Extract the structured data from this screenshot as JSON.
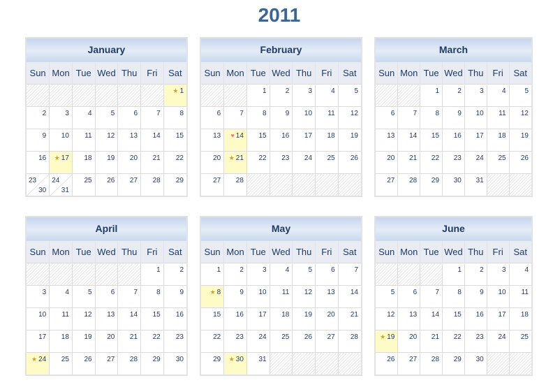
{
  "year": "2011",
  "weekdays": [
    "Sun",
    "Mon",
    "Tue",
    "Wed",
    "Thu",
    "Fri",
    "Sat"
  ],
  "icons": {
    "star": "star-icon",
    "heart": "heart-icon"
  },
  "colors": {
    "title": "#3a6595",
    "highlight": "#fffbc7",
    "star": "#d6a418",
    "heart": "#e07a86"
  },
  "months": [
    {
      "name": "January",
      "weeks": [
        [
          null,
          null,
          null,
          null,
          null,
          null,
          {
            "d": "1",
            "icon": "star"
          }
        ],
        [
          "2",
          "3",
          "4",
          "5",
          "6",
          "7",
          "8"
        ],
        [
          "9",
          "10",
          "11",
          "12",
          "13",
          "14",
          "15"
        ],
        [
          "16",
          {
            "d": "17",
            "icon": "star"
          },
          "18",
          "19",
          "20",
          "21",
          "22"
        ],
        [
          {
            "d": "23",
            "d2": "30"
          },
          {
            "d": "24",
            "d2": "31"
          },
          "25",
          "26",
          "27",
          "28",
          "29"
        ]
      ]
    },
    {
      "name": "February",
      "weeks": [
        [
          null,
          null,
          "1",
          "2",
          "3",
          "4",
          "5"
        ],
        [
          "6",
          "7",
          "8",
          "9",
          "10",
          "11",
          "12"
        ],
        [
          "13",
          {
            "d": "14",
            "icon": "heart"
          },
          "15",
          "16",
          "17",
          "18",
          "19"
        ],
        [
          "20",
          {
            "d": "21",
            "icon": "star"
          },
          "22",
          "23",
          "24",
          "25",
          "26"
        ],
        [
          "27",
          "28",
          null,
          null,
          null,
          null,
          null
        ]
      ]
    },
    {
      "name": "March",
      "weeks": [
        [
          null,
          null,
          "1",
          "2",
          "3",
          "4",
          "5"
        ],
        [
          "6",
          "7",
          "8",
          "9",
          "10",
          "11",
          "12"
        ],
        [
          "13",
          "14",
          "15",
          "16",
          "17",
          "18",
          "19"
        ],
        [
          "20",
          "21",
          "22",
          "23",
          "24",
          "25",
          "26"
        ],
        [
          "27",
          "28",
          "29",
          "30",
          "31",
          null,
          null
        ]
      ]
    },
    {
      "name": "April",
      "weeks": [
        [
          null,
          null,
          null,
          null,
          null,
          "1",
          "2"
        ],
        [
          "3",
          "4",
          "5",
          "6",
          "7",
          "8",
          "9"
        ],
        [
          "10",
          "11",
          "12",
          "13",
          "14",
          "15",
          "16"
        ],
        [
          "17",
          "18",
          "19",
          "20",
          "21",
          "22",
          "23"
        ],
        [
          {
            "d": "24",
            "icon": "star"
          },
          "25",
          "26",
          "27",
          "28",
          "29",
          "30"
        ]
      ]
    },
    {
      "name": "May",
      "weeks": [
        [
          "1",
          "2",
          "3",
          "4",
          "5",
          "6",
          "7"
        ],
        [
          {
            "d": "8",
            "icon": "star"
          },
          "9",
          "10",
          "11",
          "12",
          "13",
          "14"
        ],
        [
          "15",
          "16",
          "17",
          "18",
          "19",
          "20",
          "21"
        ],
        [
          "22",
          "23",
          "24",
          "25",
          "26",
          "27",
          "28"
        ],
        [
          "29",
          {
            "d": "30",
            "icon": "star"
          },
          "31",
          null,
          null,
          null,
          null
        ]
      ]
    },
    {
      "name": "June",
      "weeks": [
        [
          null,
          null,
          null,
          "1",
          "2",
          "3",
          "4"
        ],
        [
          "5",
          "6",
          "7",
          "8",
          "9",
          "10",
          "11"
        ],
        [
          "12",
          "13",
          "14",
          "15",
          "16",
          "17",
          "18"
        ],
        [
          {
            "d": "19",
            "icon": "star"
          },
          "20",
          "21",
          "22",
          "23",
          "24",
          "25"
        ],
        [
          "26",
          "27",
          "28",
          "29",
          "30",
          null,
          null
        ]
      ]
    }
  ]
}
